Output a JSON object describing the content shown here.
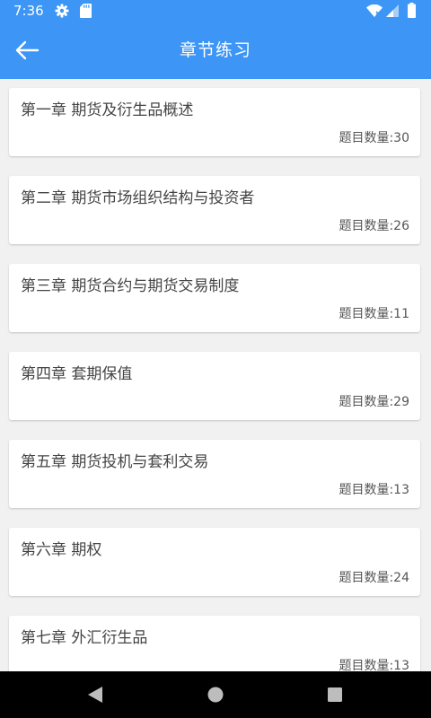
{
  "status_bar": {
    "time": "7:36",
    "icons": [
      "gear-icon",
      "sd-card-icon",
      "wifi-icon",
      "cell-signal-icon",
      "battery-icon"
    ]
  },
  "header": {
    "title": "章节练习",
    "back_icon": "arrow-left-icon"
  },
  "colors": {
    "primary": "#3d96f5",
    "background": "#f1f1f1",
    "card": "#ffffff",
    "title_text": "#444444",
    "count_text": "#555555"
  },
  "chapters": [
    {
      "title": "第一章 期货及衍生品概述",
      "count": "题目数量:30"
    },
    {
      "title": "第二章 期货市场组织结构与投资者",
      "count": "题目数量:26"
    },
    {
      "title": "第三章 期货合约与期货交易制度",
      "count": "题目数量:11"
    },
    {
      "title": "第四章 套期保值",
      "count": "题目数量:29"
    },
    {
      "title": "第五章 期货投机与套利交易",
      "count": "题目数量:13"
    },
    {
      "title": "第六章 期权",
      "count": "题目数量:24"
    },
    {
      "title": "第七章 外汇衍生品",
      "count": "题目数量:13"
    }
  ],
  "nav_bar": {
    "icons": [
      "nav-back-icon",
      "nav-home-icon",
      "nav-recents-icon"
    ]
  }
}
